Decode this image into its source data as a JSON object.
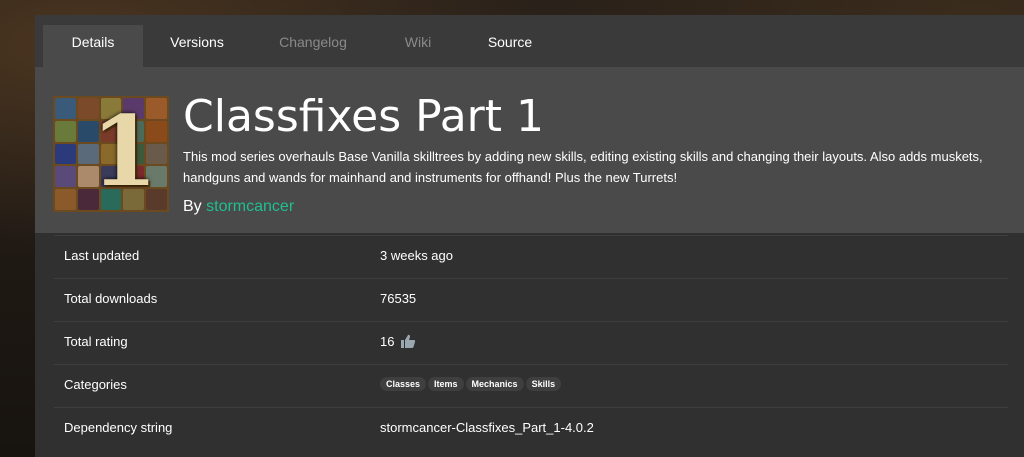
{
  "tabs": [
    {
      "label": "Details",
      "active": true
    },
    {
      "label": "Versions"
    },
    {
      "label": "Changelog",
      "disabled": true
    },
    {
      "label": "Wiki",
      "disabled": true
    },
    {
      "label": "Source"
    }
  ],
  "mod": {
    "title": "Classfixes Part 1",
    "description": "This mod series overhauls Base Vanilla skilltrees by adding new skills, editing existing skills and changing their layouts. Also adds muskets, handguns and wands for mainhand and instruments for offhand! Plus the new Turrets!",
    "by_label": "By",
    "author": "stormcancer",
    "thumbnail_glyph": "1"
  },
  "details": {
    "last_updated": {
      "label": "Last updated",
      "value": "3 weeks ago"
    },
    "total_downloads": {
      "label": "Total downloads",
      "value": "76535"
    },
    "total_rating": {
      "label": "Total rating",
      "value": "16",
      "icon": "thumbs-up-icon"
    },
    "categories": {
      "label": "Categories",
      "tags": [
        "Classes",
        "Items",
        "Mechanics",
        "Skills"
      ]
    },
    "dependency_string": {
      "label": "Dependency string",
      "value": "stormcancer-Classfixes_Part_1-4.0.2"
    }
  },
  "colors": {
    "accent": "#1fbf8f",
    "panel": "#303030",
    "hero": "#4a4a4a"
  }
}
